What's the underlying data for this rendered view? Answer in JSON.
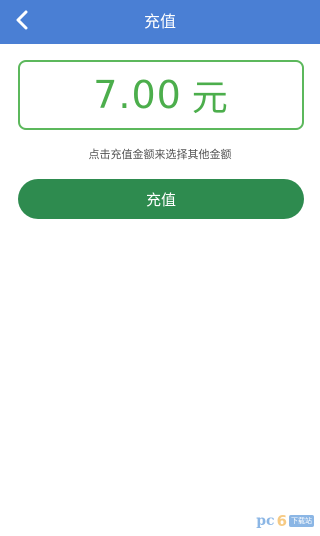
{
  "header": {
    "title": "充值",
    "back_icon": "chevron-left-icon",
    "color": "#4a7fd4"
  },
  "amount": {
    "value": "7.00",
    "unit": "元",
    "color": "#4cae4c"
  },
  "hint": "点击充值金额来选择其他金额",
  "recharge_button": {
    "label": "充值",
    "color": "#2e8b4f"
  },
  "watermark": {
    "text": "pc",
    "digit": "6",
    "badge": "下载站"
  }
}
